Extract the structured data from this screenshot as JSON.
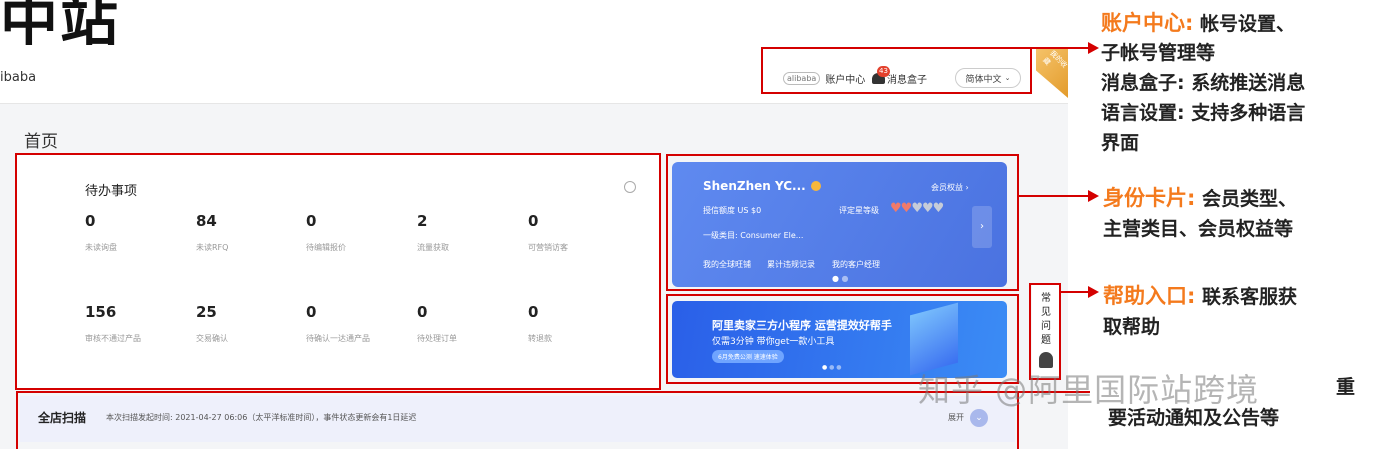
{
  "page": {
    "big_title": "中站",
    "brand": "ibaba",
    "home_title": "首页"
  },
  "header": {
    "account_logo": "alibaba",
    "account_center": "账户中心",
    "message_count": "43",
    "message_box": "消息盒子",
    "language": "简体中文",
    "ribbon": "我的收藏"
  },
  "todo": {
    "title": "待办事项",
    "stats": [
      {
        "value": "0",
        "label": "未读询盘"
      },
      {
        "value": "84",
        "label": "未读RFQ"
      },
      {
        "value": "0",
        "label": "待编辑报价"
      },
      {
        "value": "2",
        "label": "流量获取"
      },
      {
        "value": "0",
        "label": "可营销访客"
      },
      {
        "value": "156",
        "label": "审核不通过产品"
      },
      {
        "value": "25",
        "label": "交易确认"
      },
      {
        "value": "0",
        "label": "待确认一达通产品"
      },
      {
        "value": "0",
        "label": "待处理订单"
      },
      {
        "value": "0",
        "label": "转退款"
      }
    ]
  },
  "identity": {
    "company": "ShenZhen YC...",
    "benefits_link": "会员权益 ›",
    "credit": "授信额度 US $0",
    "rating_label": "评定星等级",
    "category": "一级类目: Consumer Ele...",
    "links": [
      "我的全球旺铺",
      "累计违规记录",
      "我的客户经理"
    ],
    "arrow": "›"
  },
  "promo": {
    "headline": "阿里卖家三方小程序 运营提效好帮手",
    "sub": "仅需3分钟 带你get一款小工具",
    "button": "6月免费公测 速速体验"
  },
  "help": {
    "text": "常见问题"
  },
  "scan": {
    "title": "全店扫描",
    "desc": "本次扫描发起时间: 2021-04-27 06:06（太平洋标准时间），事件状态更新会有1日延迟",
    "expand": "展开"
  },
  "annotations": {
    "a1_key": "账户中心:",
    "a1_line1": "帐号设置、",
    "a1_line2": "子帐号管理等",
    "a1_line3": "消息盒子: 系统推送消息",
    "a1_line4": "语言设置: 支持多种语言",
    "a1_line5": "界面",
    "a2_key": "身份卡片:",
    "a2_line1": "会员类型、",
    "a2_line2": "主营类目、会员权益等",
    "a3_key": "帮助入口:",
    "a3_line1": "联系客服获",
    "a3_line2": "取帮助",
    "a4_line1": "重",
    "a4_line2": "要活动通知及公告等"
  },
  "watermark": "知乎 @阿里国际站跨境",
  "colors": {
    "red": "#d40000",
    "orange": "#f47a1d",
    "card_blue": "#4a72e0"
  }
}
